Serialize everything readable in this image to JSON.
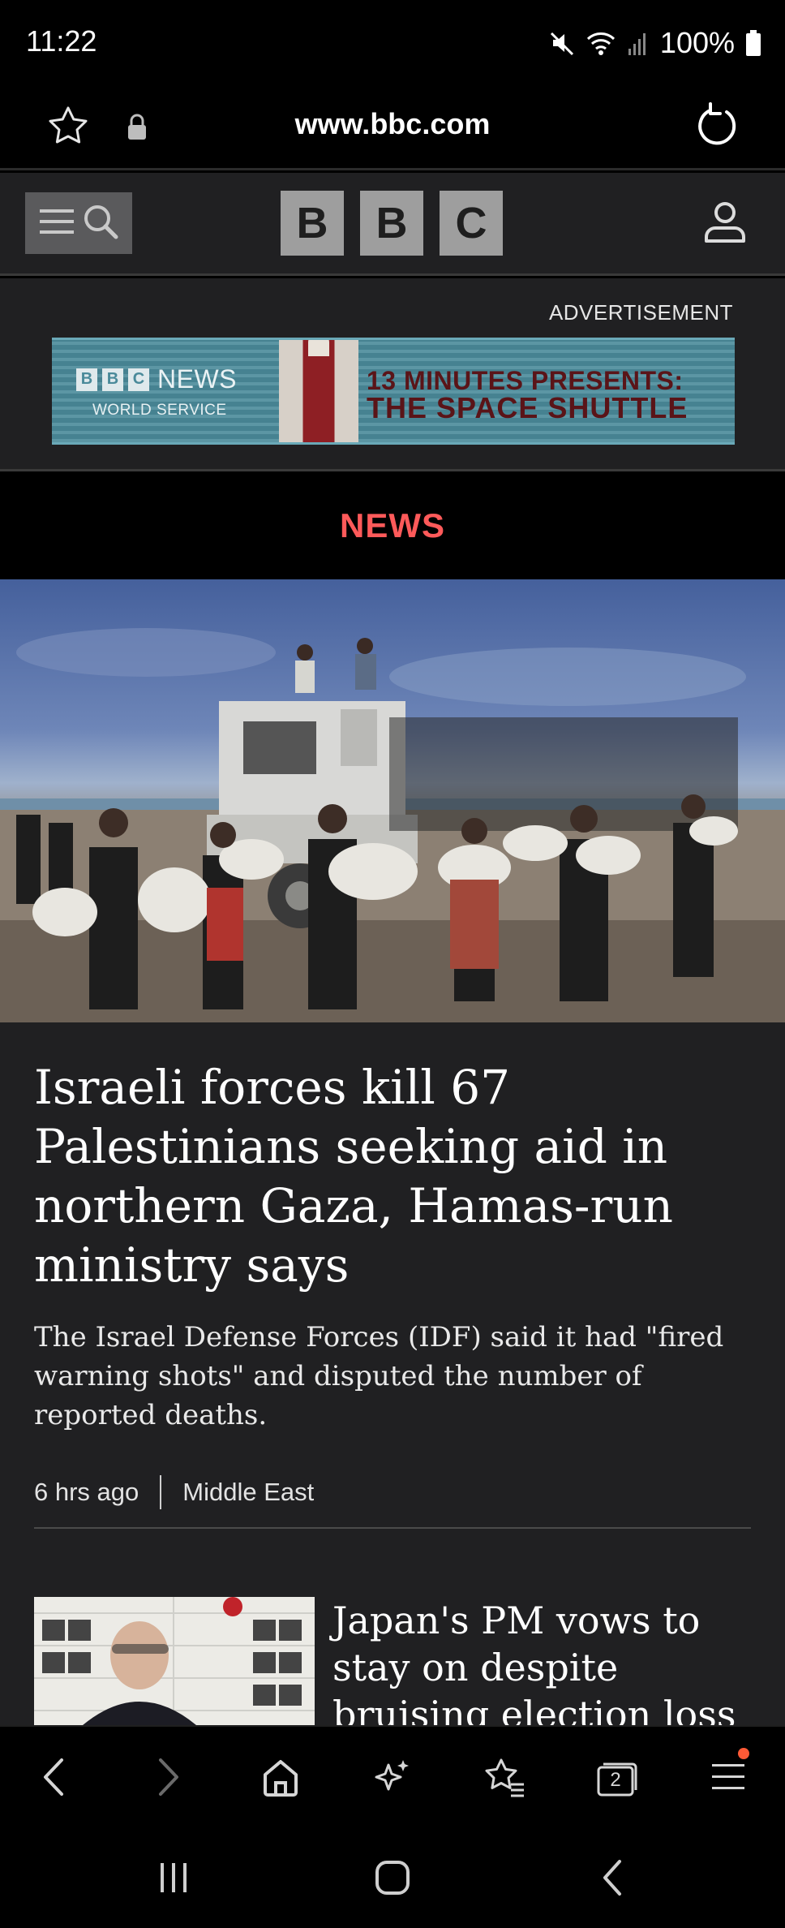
{
  "status_bar": {
    "time": "11:22",
    "battery": "100%",
    "icons": [
      "mute-icon",
      "wifi-icon",
      "signal-icon",
      "battery-icon"
    ]
  },
  "browser": {
    "url": "www.bbc.com",
    "icons": [
      "star-icon",
      "lock-icon",
      "reload-icon"
    ]
  },
  "bbc_header": {
    "logo_letters": [
      "B",
      "B",
      "C"
    ],
    "icons": [
      "menu-icon",
      "search-icon",
      "account-icon"
    ]
  },
  "advertisement": {
    "label": "ADVERTISEMENT",
    "brand_letters": [
      "B",
      "B",
      "C"
    ],
    "brand_name": "NEWS",
    "brand_sub": "WORLD SERVICE",
    "headline_line1": "13 MINUTES PRESENTS:",
    "headline_line2": "THE SPACE SHUTTLE"
  },
  "section": {
    "title": "NEWS"
  },
  "main_article": {
    "headline": "Israeli forces kill 67 Palestinians seeking aid in northern Gaza, Hamas-run ministry says",
    "summary": "The Israel Defense Forces (IDF) said it had \"fired warning shots\" and disputed the number of reported deaths.",
    "time": "6 hrs ago",
    "topic": "Middle East"
  },
  "second_article": {
    "headline": "Japan's PM vows to stay on despite bruising election loss"
  },
  "bottom_toolbar": {
    "tab_count": "2",
    "icons": [
      "back-icon",
      "forward-icon",
      "home-icon",
      "ai-sparkle-icon",
      "bookmarks-icon",
      "tabs-icon",
      "menu-icon"
    ],
    "accent_color": "#ff5a36"
  },
  "system_nav": {
    "icons": [
      "recent-apps-icon",
      "home-icon",
      "back-icon"
    ]
  },
  "colors": {
    "section_title": "#ff5a5a",
    "header_bg": "#202022",
    "article_bg": "#202022"
  }
}
